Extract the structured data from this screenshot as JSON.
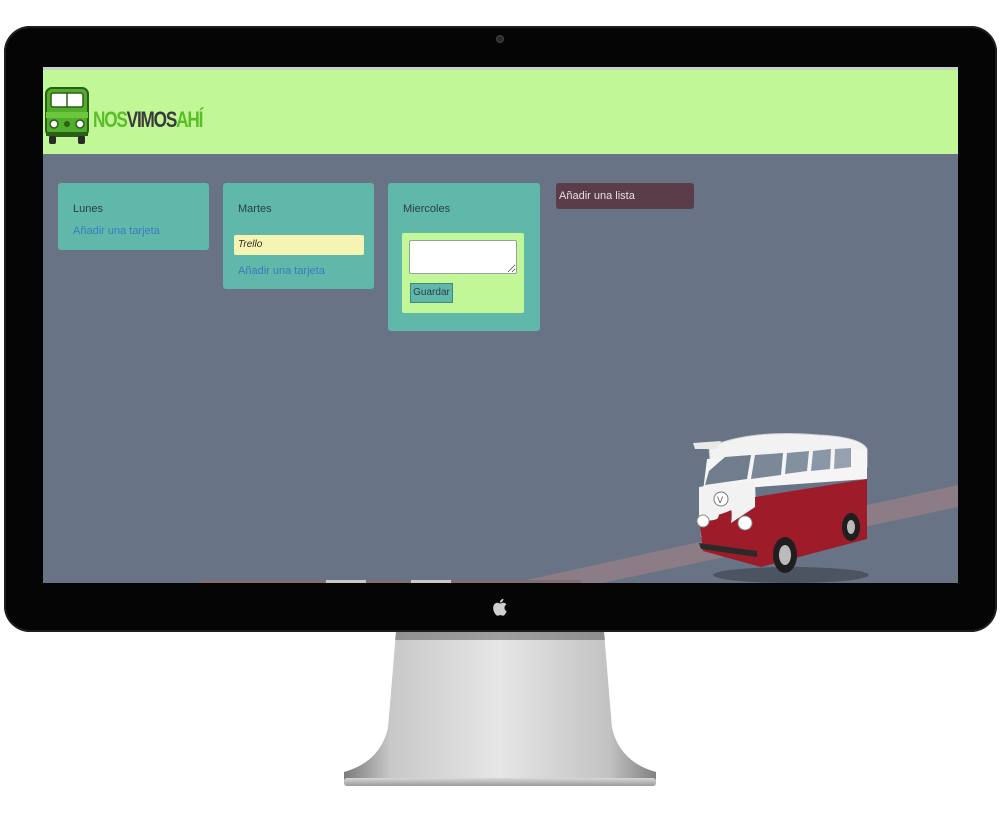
{
  "brand": {
    "word1": "NOS",
    "word2": "VIMOS",
    "word3": "AHÍ",
    "green": "#5bbd2a",
    "header_color": "#c1f796"
  },
  "board": {
    "background": "#687386",
    "lists": [
      {
        "title": "Lunes",
        "add_card_label": "Añadir una tarjeta",
        "cards": []
      },
      {
        "title": "Martes",
        "add_card_label": "Añadir una tarjeta",
        "cards": [
          "Trello"
        ]
      },
      {
        "title": "Miercoles",
        "composer": {
          "input_value": "",
          "save_label": "Guardar"
        }
      }
    ],
    "add_list_label": "Añadir una lista",
    "list_color": "#5fb8aa",
    "add_list_color": "#5b3d4a"
  },
  "icons": {
    "logo": "van-logo-icon",
    "illustration": "vw-bus-icon",
    "apple": "apple-logo-icon"
  }
}
